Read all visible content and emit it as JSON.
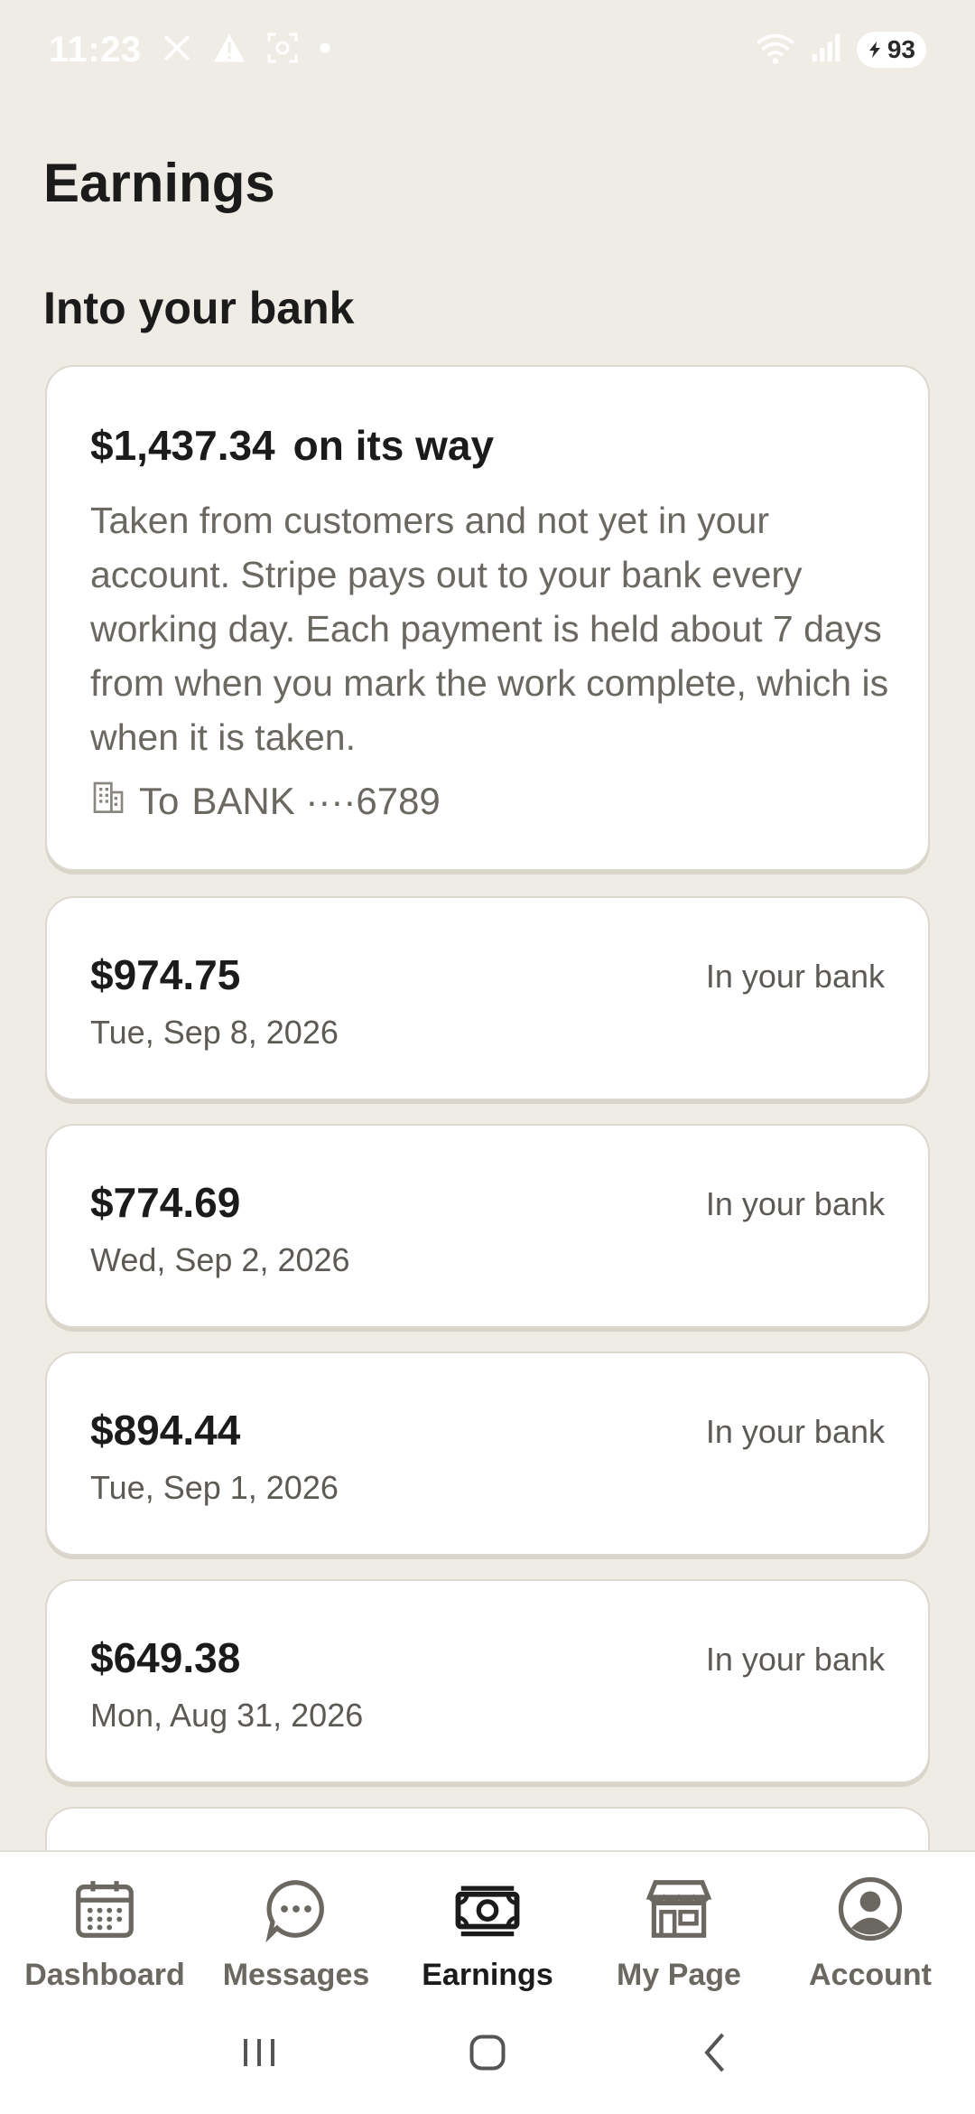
{
  "status_bar": {
    "time": "11:23",
    "battery": "93",
    "icons": [
      "x-icon",
      "warning-icon",
      "screenshot-icon",
      "dot-icon",
      "wifi-icon",
      "signal-icon",
      "battery-icon"
    ]
  },
  "page": {
    "title": "Earnings",
    "section_title": "Into your bank"
  },
  "pending": {
    "amount": "$1,437.34",
    "label": "on its way",
    "description": "Taken from customers and not yet in your account. Stripe pays out to your bank every working day. Each payment is held about 7 days from when you mark the work complete, which is when it is taken.",
    "bank_prefix": "To",
    "bank_name": "BANK ····6789"
  },
  "payouts": [
    {
      "amount": "$974.75",
      "date": "Tue, Sep 8, 2026",
      "status": "In your bank"
    },
    {
      "amount": "$774.69",
      "date": "Wed, Sep 2, 2026",
      "status": "In your bank"
    },
    {
      "amount": "$894.44",
      "date": "Tue, Sep 1, 2026",
      "status": "In your bank"
    },
    {
      "amount": "$649.38",
      "date": "Mon, Aug 31, 2026",
      "status": "In your bank"
    }
  ],
  "nav": {
    "items": [
      {
        "label": "Dashboard",
        "icon": "calendar-icon"
      },
      {
        "label": "Messages",
        "icon": "chat-icon"
      },
      {
        "label": "Earnings",
        "icon": "money-icon",
        "active": true
      },
      {
        "label": "My Page",
        "icon": "storefront-icon"
      },
      {
        "label": "Account",
        "icon": "user-icon"
      }
    ]
  },
  "colors": {
    "background": "#efece6",
    "card": "#ffffff",
    "text_primary": "#1b1b1b",
    "text_secondary": "#6b6862"
  }
}
